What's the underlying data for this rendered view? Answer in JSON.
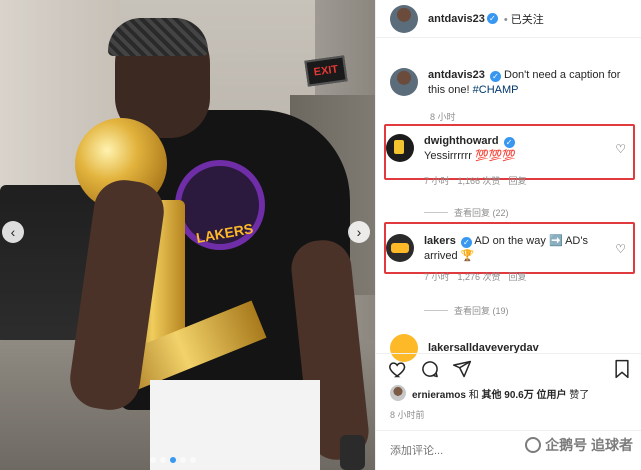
{
  "post": {
    "author": "antdavis23",
    "follow_status": "已关注"
  },
  "caption": {
    "username": "antdavis23",
    "text": "Don't need a caption for this one!",
    "hashtag": "#CHAMP",
    "time": "8 小时"
  },
  "comments": [
    {
      "username": "dwighthoward",
      "text": "Yessirrrrrr",
      "emoji": "💯💯💯",
      "time": "7 小时",
      "likes": "1,166 次赞",
      "reply": "回复",
      "view_replies": "查看回复 (22)"
    },
    {
      "username": "lakers",
      "text_before": "AD on the way",
      "arrow": "➡️",
      "text_after": "AD's arrived",
      "emoji": "🏆",
      "time": "7 小时",
      "likes": "1,276 次赞",
      "reply": "回复",
      "view_replies": "查看回复 (19)"
    }
  ],
  "partial_comment": {
    "username": "lakersalldaveverydav"
  },
  "liked_by": {
    "username": "ernieramos",
    "joiner": "和",
    "others": "其他 90.6万 位用户",
    "suffix": "赞了"
  },
  "post_time": "8 小时前",
  "add_comment": {
    "placeholder": "添加评论..."
  },
  "photo": {
    "exit_sign": "EXIT",
    "shirt_text": "LAKERS",
    "slides": 5,
    "active_slide": 2
  },
  "watermark": {
    "text": "企鹅号 追球者"
  },
  "icons": {
    "prev": "chevron-left-icon",
    "next": "chevron-right-icon",
    "like": "heart-icon",
    "comment": "comment-icon",
    "share": "paper-plane-icon",
    "save": "bookmark-icon"
  },
  "colors": {
    "verified": "#3897f0",
    "highlight_box": "#e0393e",
    "secondary_text": "#8e8e8e",
    "hashtag": "#00376b"
  }
}
